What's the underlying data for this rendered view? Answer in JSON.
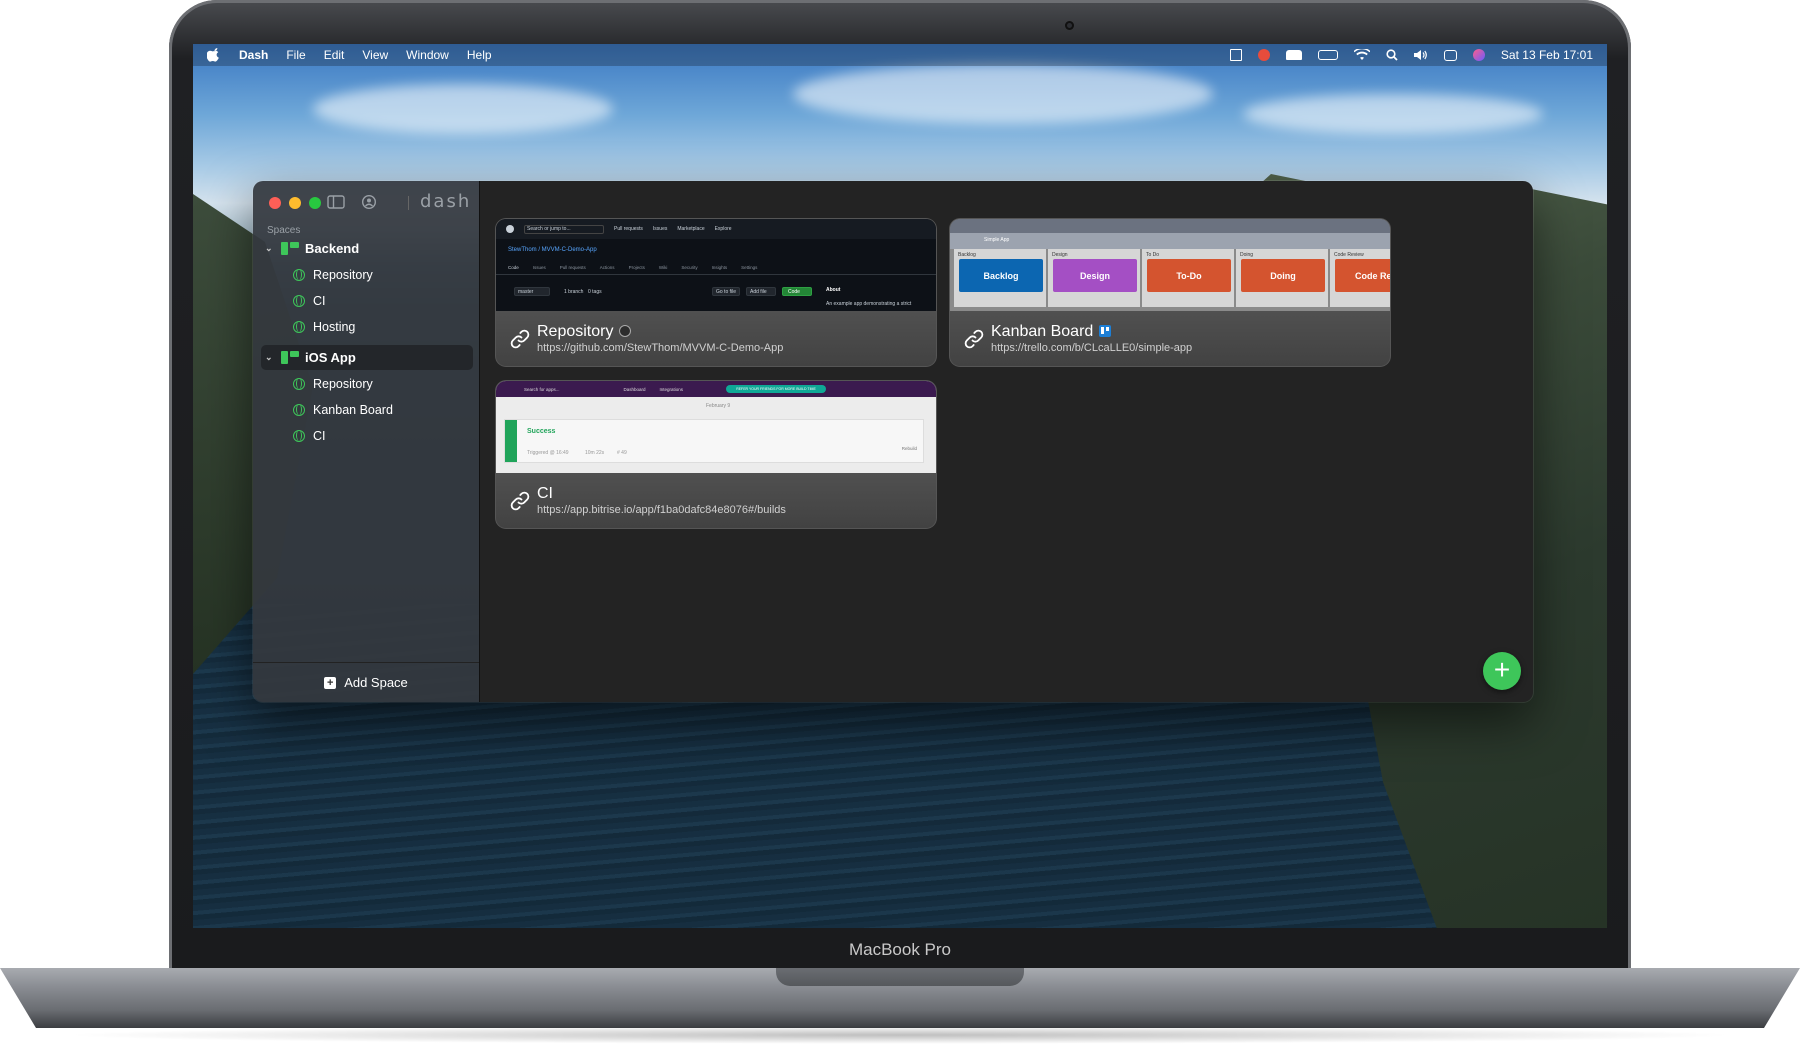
{
  "menubar": {
    "app_name": "Dash",
    "items": [
      "File",
      "Edit",
      "View",
      "Window",
      "Help"
    ],
    "clock": "Sat 13 Feb  17:01"
  },
  "app": {
    "brand": "dash",
    "spaces_label": "Spaces",
    "add_space_label": "Add Space",
    "accent_color": "#3ec65a"
  },
  "sidebar": {
    "groups": [
      {
        "label": "Backend",
        "items": [
          {
            "label": "Repository"
          },
          {
            "label": "CI"
          },
          {
            "label": "Hosting"
          }
        ]
      },
      {
        "label": "iOS App",
        "selected": true,
        "items": [
          {
            "label": "Repository"
          },
          {
            "label": "Kanban Board"
          },
          {
            "label": "CI"
          }
        ]
      }
    ]
  },
  "cards": [
    {
      "title": "Repository",
      "url": "https://github.com/StewThom/MVVM-C-Demo-App",
      "thumb": {
        "search": "Search or jump to...",
        "nav": [
          "Pull requests",
          "Issues",
          "Marketplace",
          "Explore"
        ],
        "repo": "StewThom / MVVM-C-Demo-App",
        "tabs": [
          "Code",
          "Issues",
          "Pull requests",
          "Actions",
          "Projects",
          "Wiki",
          "Security",
          "Insights",
          "Settings"
        ],
        "branch": "master",
        "branches": "1 branch",
        "tags": "0 tags",
        "go_to_file": "Go to file",
        "add_file": "Add file",
        "code": "Code",
        "about": "About",
        "about_text": "An example app demonstrating a strict"
      }
    },
    {
      "title": "Kanban Board",
      "url": "https://trello.com/b/CLcaLLE0/simple-app",
      "thumb": {
        "board": "Simple App",
        "columns": [
          {
            "label": "Backlog",
            "card": "Backlog",
            "color": "#0c66b1"
          },
          {
            "label": "Design",
            "card": "Design",
            "color": "#a44fc4"
          },
          {
            "label": "To Do",
            "card": "To-Do",
            "color": "#d4542f"
          },
          {
            "label": "Doing",
            "card": "Doing",
            "color": "#d4542f"
          },
          {
            "label": "Code Review",
            "card": "Code Revi",
            "color": "#d4542f"
          }
        ]
      }
    },
    {
      "title": "CI",
      "url": "https://app.bitrise.io/app/f1ba0dafc84e8076#/builds",
      "thumb": {
        "search": "Search for apps...",
        "nav": [
          "Dashboard",
          "Integrations"
        ],
        "promo": "REFER YOUR FRIENDS FOR MORE BUILD TIME",
        "date": "February 9",
        "status": "Success",
        "triggered": "Triggered @ 16:49",
        "duration": "10m 22s",
        "build": "# 49",
        "rebuild": "Rebuild"
      }
    }
  ],
  "device": {
    "label": "MacBook Pro"
  }
}
